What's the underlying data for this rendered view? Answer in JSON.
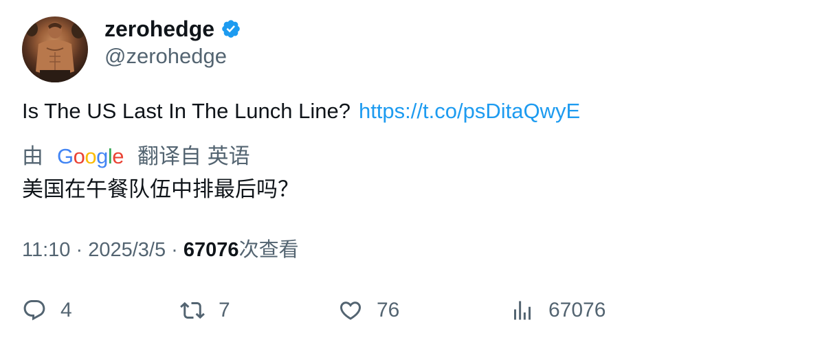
{
  "author": {
    "display_name": "zerohedge",
    "handle": "@zerohedge",
    "verified_color": "#1d9bf0"
  },
  "tweet": {
    "text": "Is The US Last In The Lunch Line?",
    "link": "https://t.co/psDitaQwyE"
  },
  "translation": {
    "prefix": "由",
    "provider": "Google",
    "suffix": "翻译自 英语",
    "text": "美国在午餐队伍中排最后吗？"
  },
  "meta": {
    "time": "11:10",
    "separator": "·",
    "date": "2025/3/5",
    "views": "67076",
    "views_label": "次查看"
  },
  "actions": {
    "replies": "4",
    "retweets": "7",
    "likes": "76",
    "views": "67076"
  },
  "colors": {
    "link": "#1d9bf0",
    "secondary_text": "#536471",
    "primary_text": "#0f1419"
  },
  "icons": [
    "verified-badge-icon",
    "reply-icon",
    "retweet-icon",
    "like-icon",
    "views-icon",
    "google-logo"
  ]
}
